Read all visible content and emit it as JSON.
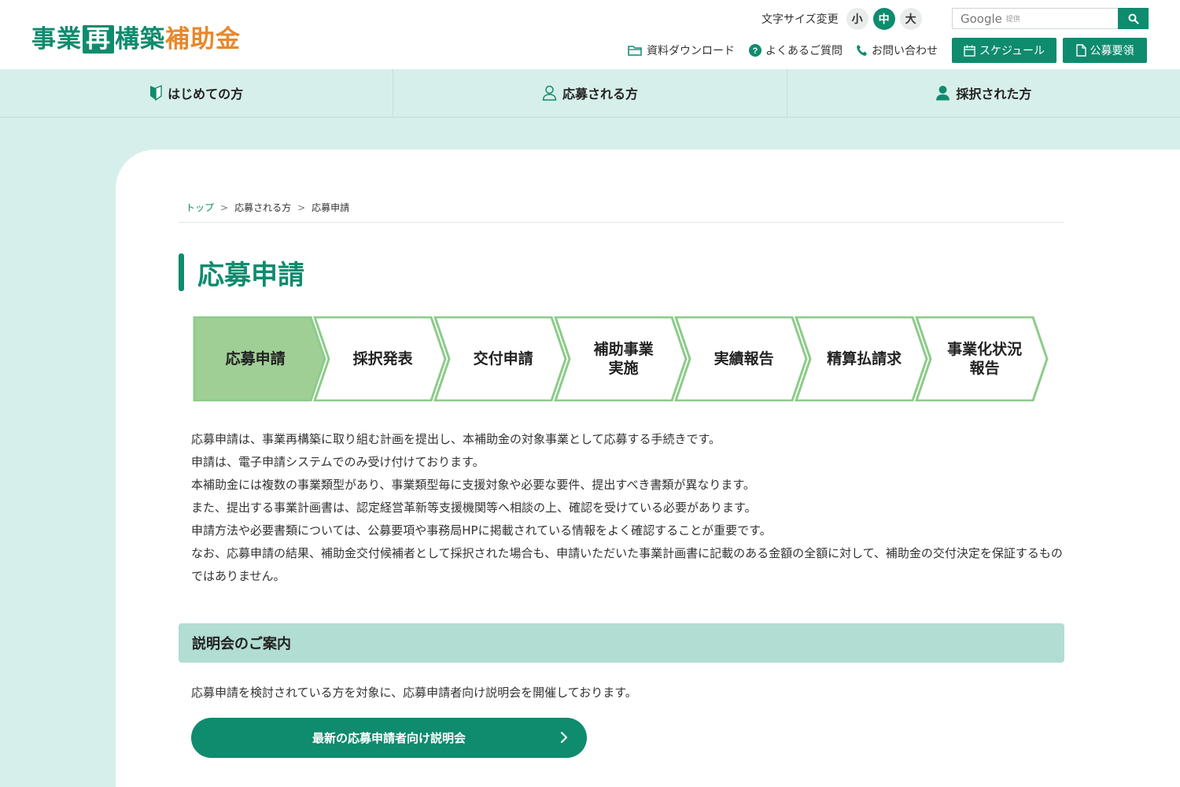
{
  "header": {
    "logo": {
      "part1": "事業",
      "part2": "再",
      "part3": "構築",
      "part4": "補助金"
    },
    "font_size": {
      "label": "文字サイズ変更",
      "small": "小",
      "medium": "中",
      "large": "大",
      "selected": "中"
    },
    "search": {
      "google": "Google",
      "provided": "提供"
    },
    "links": {
      "downloads": "資料ダウンロード",
      "faq": "よくあるご質問",
      "contact": "お問い合わせ"
    },
    "buttons": {
      "schedule": "スケジュール",
      "guidelines": "公募要領"
    }
  },
  "nav": {
    "items": [
      {
        "label": "はじめての方",
        "icon": "beginner-mark-icon"
      },
      {
        "label": "応募される方",
        "icon": "user-outline-icon"
      },
      {
        "label": "採択された方",
        "icon": "user-filled-icon"
      }
    ]
  },
  "breadcrumb": {
    "home": "トップ",
    "sep": ">",
    "parent": "応募される方",
    "current": "応募申請"
  },
  "page_title": "応募申請",
  "steps": {
    "active_index": 0,
    "labels": [
      "応募申請",
      "採択発表",
      "交付申請",
      "補助事業\n実施",
      "実績報告",
      "精算払請求",
      "事業化状況\n報告"
    ]
  },
  "intro": [
    "応募申請は、事業再構築に取り組む計画を提出し、本補助金の対象事業として応募する手続きです。",
    "申請は、電子申請システムでのみ受け付けております。",
    "本補助金には複数の事業類型があり、事業類型毎に支援対象や必要な要件、提出すべき書類が異なります。",
    "また、提出する事業計画書は、認定経営革新等支援機関等へ相談の上、確認を受けている必要があります。",
    "申請方法や必要書類については、公募要項や事務局HPに掲載されている情報をよく確認することが重要です。",
    "なお、応募申請の結果、補助金交付候補者として採択された場合も、申請いただいた事業計画書に記載のある金額の全額に対して、補助金の交付決定を保証するものではありません。"
  ],
  "seminar": {
    "heading": "説明会のご案内",
    "text": "応募申請を検討されている方を対象に、応募申請者向け説明会を開催しております。",
    "button": "最新の応募申請者向け説明会"
  },
  "colors": {
    "brand": "#0f8b6e",
    "accent_orange": "#e8882b",
    "nav_bg": "#d7efea",
    "step_active": "#9fcf95",
    "step_border": "#8ccc8a",
    "section_head": "#b1ddd2"
  }
}
